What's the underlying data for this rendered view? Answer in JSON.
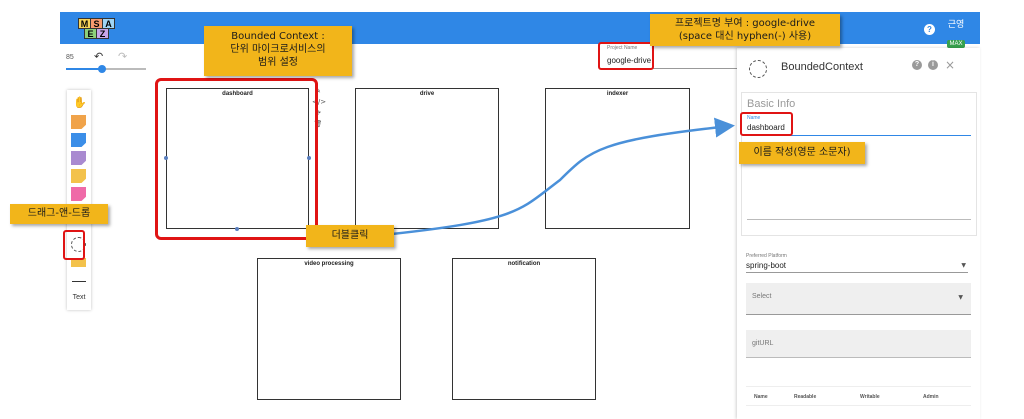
{
  "logo": {
    "letters": [
      "M",
      "S",
      "A",
      "E",
      "Z"
    ],
    "colors": [
      "#f7d358",
      "#f79a6e",
      "#9fd4f5",
      "#8ed07a",
      "#c7a6e8"
    ]
  },
  "header": {
    "help_icon": "?",
    "user_name": "근영",
    "user_badge": "MAX"
  },
  "toolbar": {
    "zoom_value": "85",
    "zoom_fraction": 0.45,
    "undo_icon": "↶",
    "redo_icon": "↷"
  },
  "palette": {
    "hand_icon": "✋",
    "sticky_colors": [
      "#f0a34a",
      "#3b8ee8",
      "#a98ad0",
      "#f3c24b",
      "#ef6aa8",
      "#f0d84a"
    ],
    "text_label": "Text"
  },
  "canvas": {
    "contexts": [
      "dashboard",
      "drive",
      "indexer",
      "video processing",
      "notification"
    ],
    "side_tools": [
      "✎",
      "</>",
      "⟳",
      "🗑"
    ]
  },
  "project": {
    "label": "Project Name",
    "value": "google-drive"
  },
  "panel": {
    "title": "BoundedContext",
    "help_icon": "?",
    "info_icon": "i",
    "close_icon": "×",
    "basic_info": "Basic Info",
    "name_label": "Name",
    "name_value": "dashboard",
    "platform_label": "Preferred Platform",
    "platform_value": "spring-boot",
    "select_placeholder": "Select",
    "git_placeholder": "gitURL",
    "table_headers": [
      "Name",
      "Readable",
      "Writable",
      "Admin"
    ]
  },
  "annotations": {
    "bounded_context": [
      "Bounded Context :",
      "단위 마이크로서비스의",
      "범위 설정"
    ],
    "project_name": [
      "프로젝트명 부여 : google-drive",
      "(space 대신 hyphen(-) 사용)"
    ],
    "drag_drop": "드래그-앤-드롭",
    "double_click": "더블클릭",
    "name_hint": "이름 작성(영문 소문자)",
    "red": "#e01414",
    "note_color": "#f2b51a",
    "arrow_color": "#4a90d9"
  }
}
